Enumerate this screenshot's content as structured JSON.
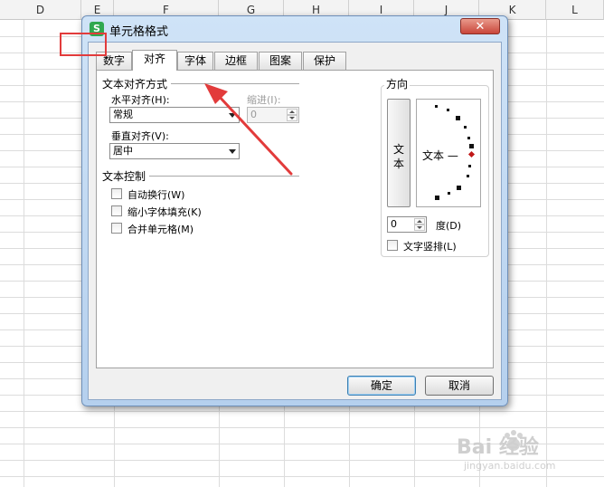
{
  "sheet": {
    "columns": [
      "D",
      "E",
      "F",
      "G",
      "H",
      "I",
      "J",
      "K",
      "L"
    ]
  },
  "dialog": {
    "title": "单元格格式",
    "app_icon": "S",
    "close_symbol": "✕",
    "tabs": [
      {
        "label": "数字",
        "active": false
      },
      {
        "label": "对齐",
        "active": true
      },
      {
        "label": "字体",
        "active": false
      },
      {
        "label": "边框",
        "active": false
      },
      {
        "label": "图案",
        "active": false
      },
      {
        "label": "保护",
        "active": false
      }
    ],
    "text_alignment": {
      "title": "文本对齐方式",
      "horizontal_label": "水平对齐(H):",
      "horizontal_value": "常规",
      "indent_label": "缩进(I):",
      "indent_value": "0",
      "vertical_label": "垂直对齐(V):",
      "vertical_value": "居中"
    },
    "text_control": {
      "title": "文本控制",
      "options": [
        "自动换行(W)",
        "缩小字体填充(K)",
        "合并单元格(M)"
      ]
    },
    "orientation": {
      "title": "方向",
      "vertical_text": [
        "文",
        "本"
      ],
      "dial_label": "文本 —",
      "degrees_value": "0",
      "degrees_label": "度(D)",
      "vertical_text_option": "文字竖排(L)"
    },
    "buttons": {
      "ok": "确定",
      "cancel": "取消"
    }
  },
  "colors": {
    "annotation_red": "#e23b3b",
    "title_gradient": "#cfe3f7",
    "dial_marker": "#c01818"
  },
  "watermark": {
    "text": "Bai 经验",
    "sub": "jingyan.baidu.com"
  }
}
